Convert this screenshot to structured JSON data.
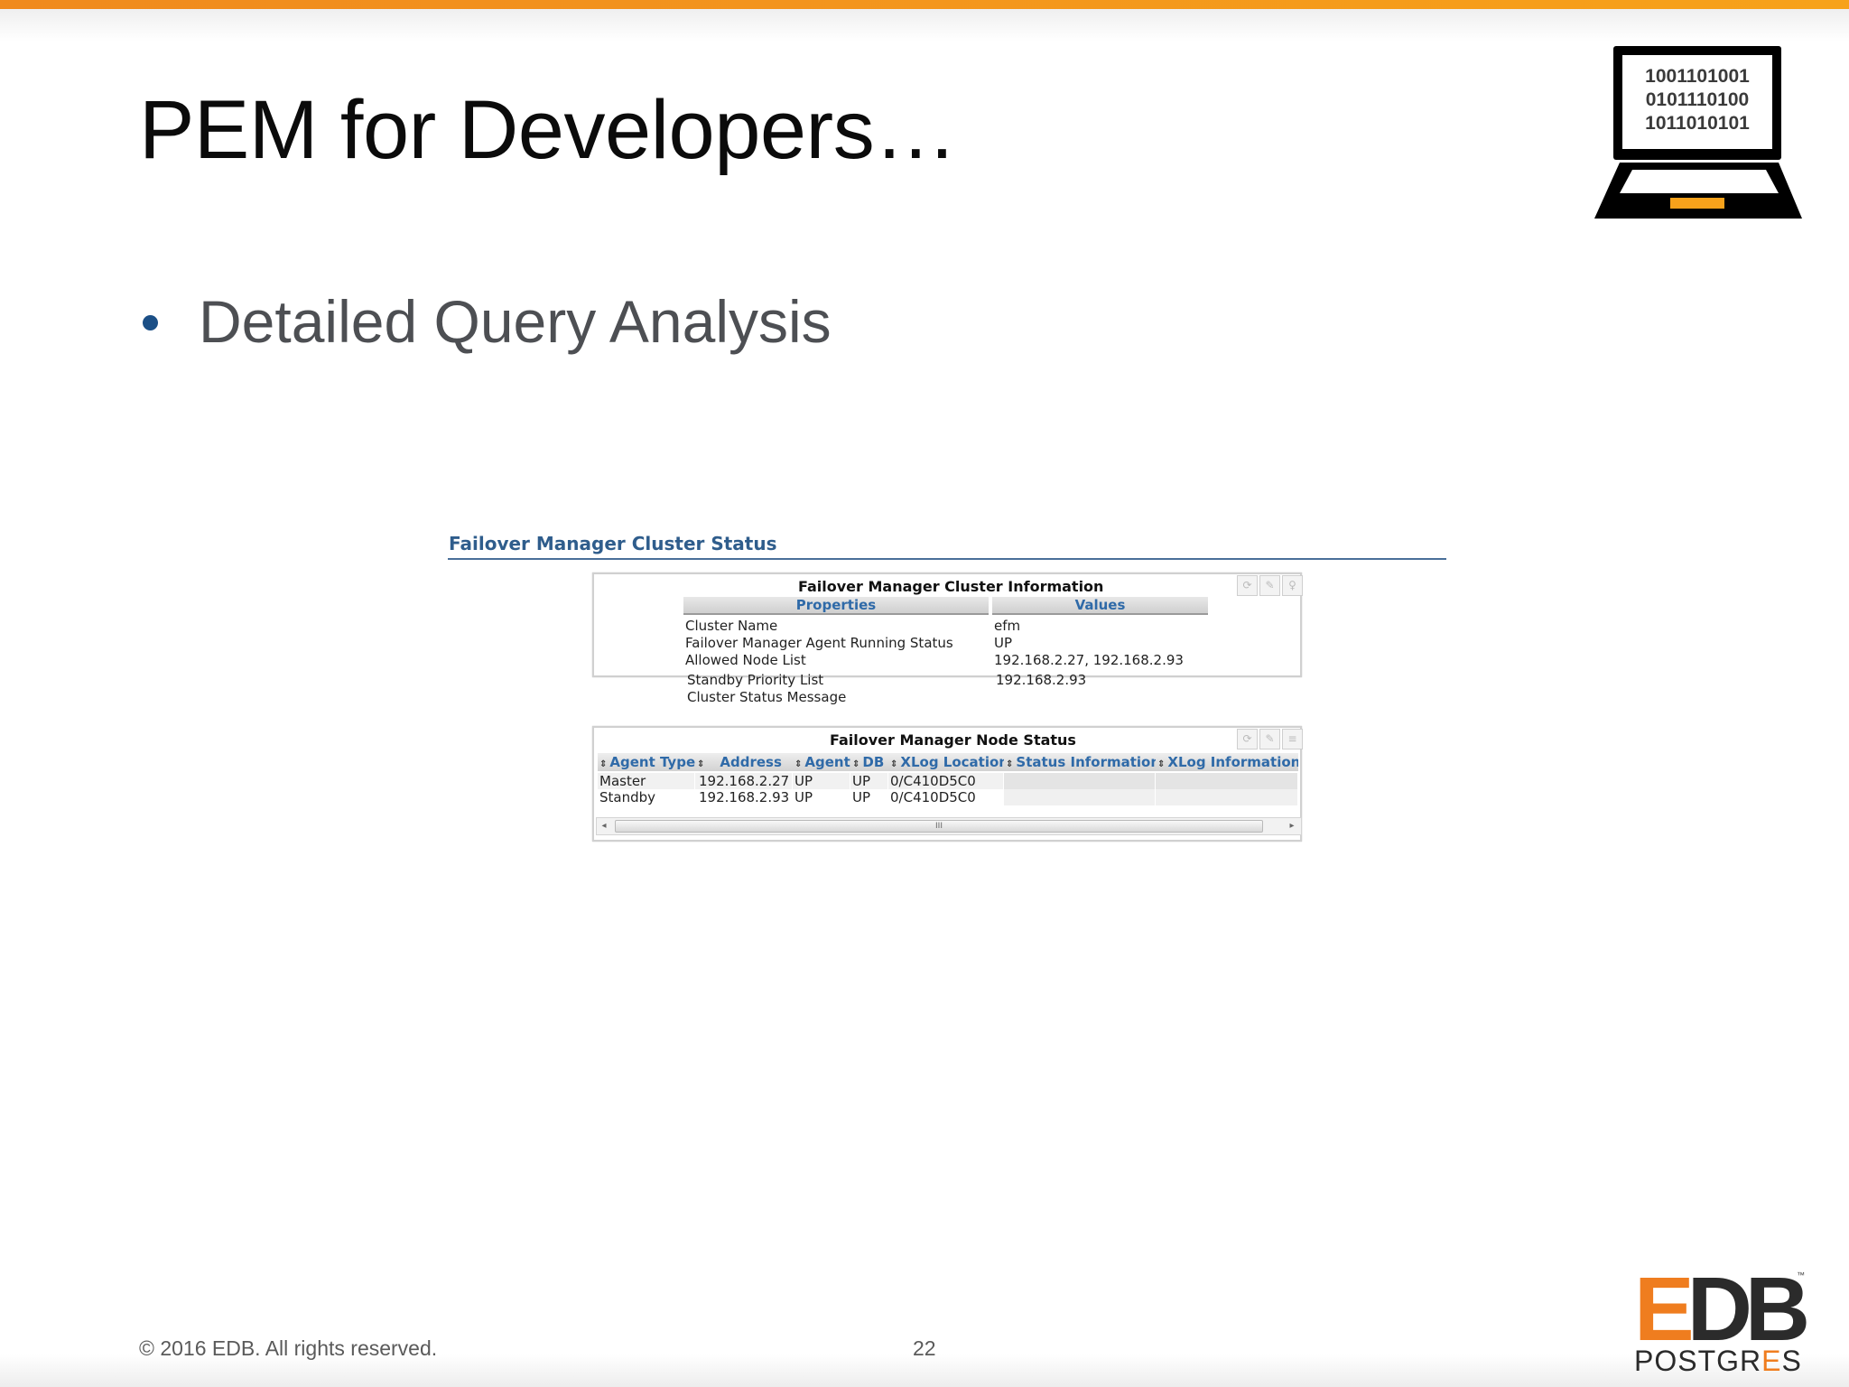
{
  "slide": {
    "title": "PEM for Developers…",
    "bullet": "Detailed Query Analysis",
    "footer_copyright": "© 2016 EDB. All rights reserved.",
    "page_number": "22",
    "accent_color": "#f7a21b",
    "bullet_color": "#1b4f86"
  },
  "laptop_icon": {
    "lines": [
      "1001101001",
      "0101110100",
      "1011010101"
    ]
  },
  "logo": {
    "main": "EDB",
    "main_e": "E",
    "main_rest": "DB",
    "tm": "™",
    "sub_a": "POSTGR",
    "sub_e": "E",
    "sub_b": "S"
  },
  "screenshot": {
    "section_title": "Failover Manager Cluster Status",
    "cluster_info": {
      "title": "Failover Manager Cluster Information",
      "col_properties": "Properties",
      "col_values": "Values",
      "tools": [
        "refresh-icon",
        "wrench-icon",
        "lightbulb-icon"
      ],
      "rows": [
        {
          "property": "Cluster Name",
          "value": "efm"
        },
        {
          "property": "Failover Manager Agent Running Status",
          "value": "UP"
        },
        {
          "property": "Allowed Node List",
          "value": "192.168.2.27, 192.168.2.93"
        },
        {
          "property": "Standby Priority List",
          "value": "192.168.2.93"
        },
        {
          "property": "Cluster Status Message",
          "value": ""
        }
      ]
    },
    "node_status": {
      "title": "Failover Manager Node Status",
      "tools": [
        "refresh-icon",
        "wrench-icon",
        "grid-icon"
      ],
      "columns": [
        "Agent Type",
        "Address",
        "Agent",
        "DB",
        "XLog Location",
        "Status Information",
        "XLog Information"
      ],
      "rows": [
        [
          "Master",
          "192.168.2.27",
          "UP",
          "UP",
          "0/C410D5C0",
          "",
          ""
        ],
        [
          "Standby",
          "192.168.2.93",
          "UP",
          "UP",
          "0/C410D5C0",
          "",
          ""
        ]
      ],
      "scroll_left": "◂",
      "scroll_grip": "III",
      "scroll_right": "▸"
    }
  }
}
